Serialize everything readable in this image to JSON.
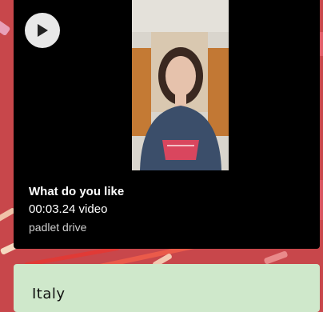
{
  "post": {
    "title": "What do you like",
    "meta": "00:03.24 video",
    "source": "padlet drive",
    "play_icon": "play-icon"
  },
  "next_post": {
    "title": "Italy"
  },
  "colors": {
    "background": "#c8474b",
    "card": "#000000",
    "note_card": "#cfe8cb"
  }
}
